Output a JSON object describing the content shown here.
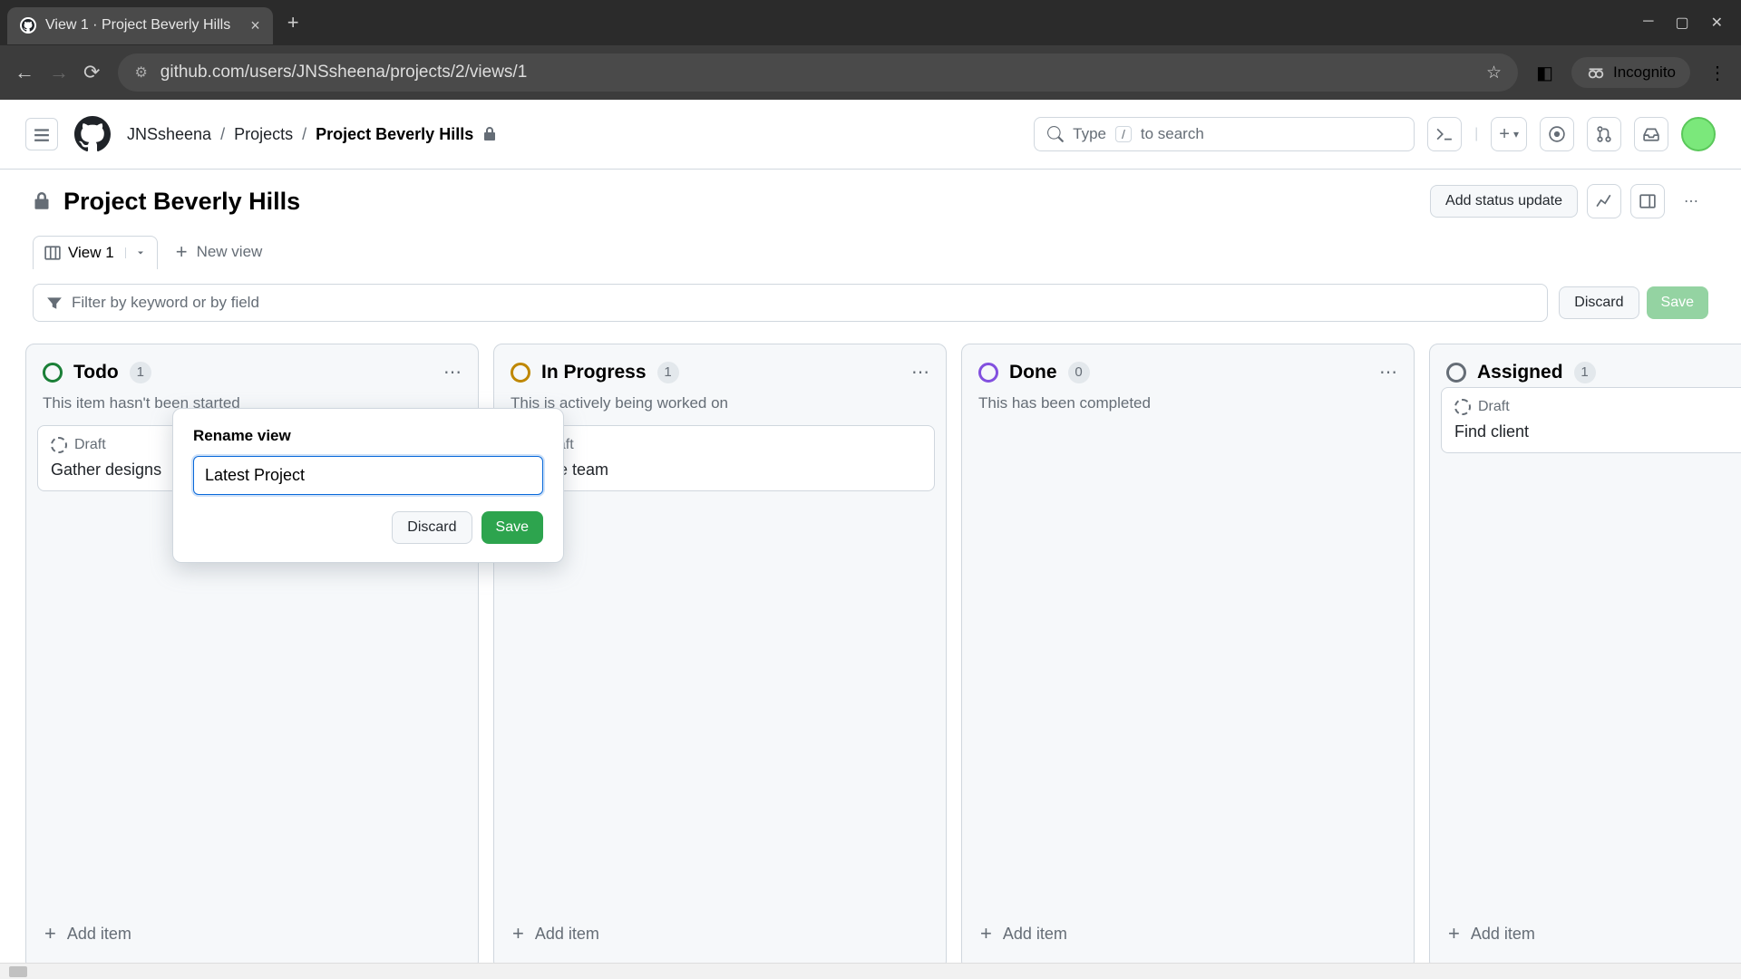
{
  "browser": {
    "tab_title": "View 1 · Project Beverly Hills",
    "url": "github.com/users/JNSsheena/projects/2/views/1",
    "incognito": "Incognito"
  },
  "header": {
    "breadcrumb": {
      "owner": "JNSsheena",
      "projects": "Projects",
      "current": "Project Beverly Hills"
    },
    "search_placeholder": "Type",
    "search_suffix": "to search",
    "search_key": "/"
  },
  "project": {
    "title": "Project Beverly Hills",
    "status_btn": "Add status update"
  },
  "tabs": {
    "active": "View 1",
    "new_view": "New view"
  },
  "filter": {
    "placeholder": "Filter by keyword or by field",
    "discard": "Discard",
    "save": "Save"
  },
  "rename": {
    "label": "Rename view",
    "value": "Latest Project",
    "discard": "Discard",
    "save": "Save"
  },
  "columns": [
    {
      "title": "Todo",
      "count": "1",
      "desc": "This item hasn't been started",
      "status": "todo",
      "cards": [
        {
          "draft": "Draft",
          "title": "Gather designs"
        }
      ]
    },
    {
      "title": "In Progress",
      "count": "1",
      "desc": "This is actively being worked on",
      "status": "progress",
      "cards": [
        {
          "draft": "Draft",
          "title": "Create team"
        }
      ]
    },
    {
      "title": "Done",
      "count": "0",
      "desc": "This has been completed",
      "status": "done",
      "cards": []
    },
    {
      "title": "Assigned",
      "count": "1",
      "desc": "",
      "status": "assigned",
      "cards": [
        {
          "draft": "Draft",
          "title": "Find client"
        }
      ]
    }
  ],
  "add_item": "Add item"
}
